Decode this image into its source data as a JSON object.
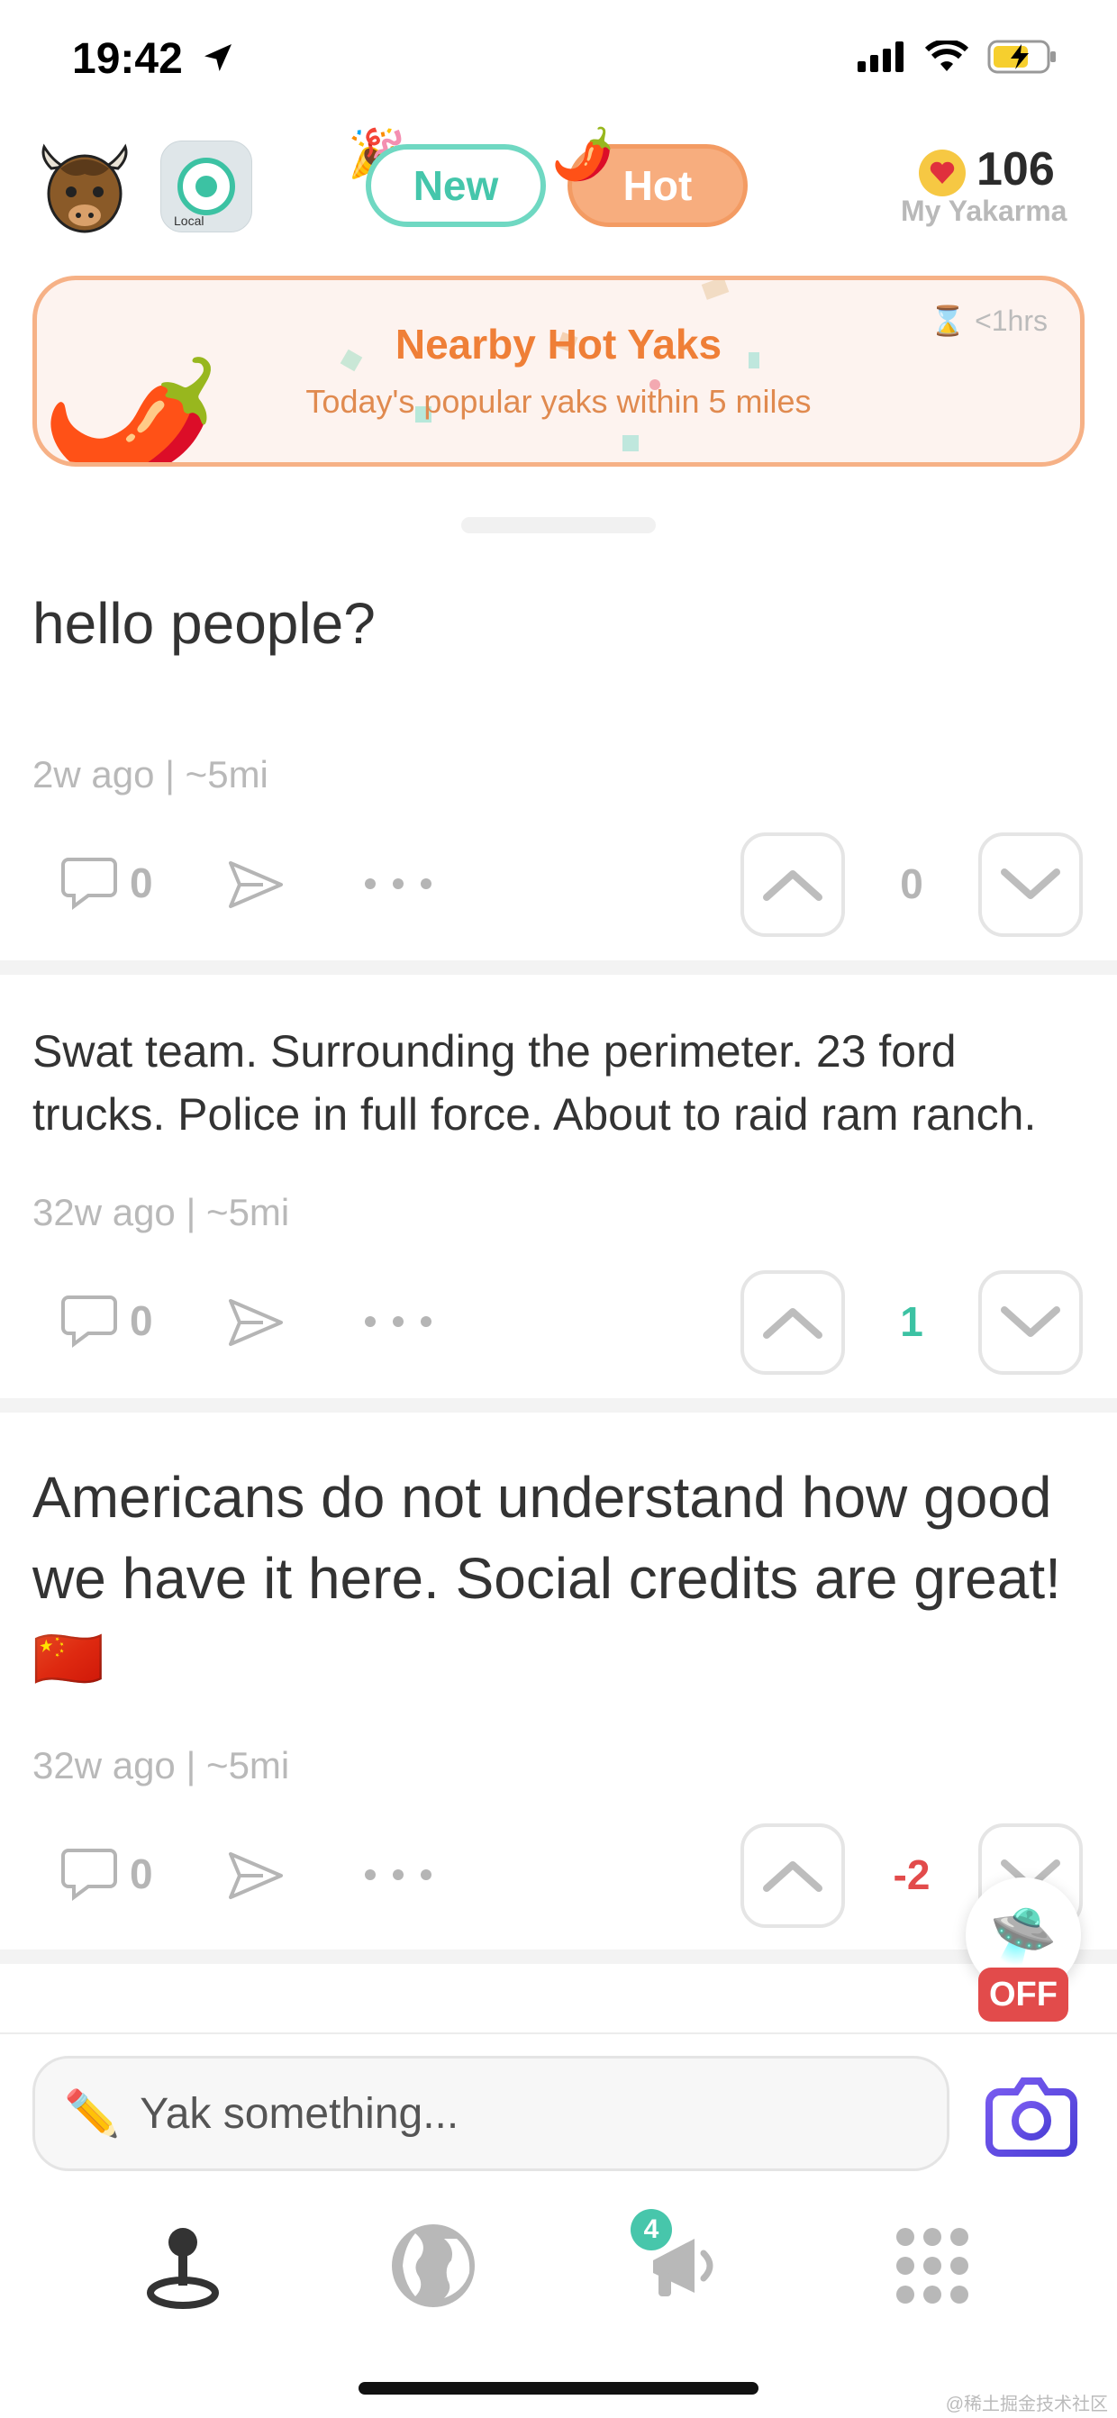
{
  "status_bar": {
    "time": "19:42"
  },
  "header": {
    "tabs": [
      {
        "label": "New"
      },
      {
        "label": "Hot"
      }
    ],
    "yakarma": {
      "count": "106",
      "label": "My Yakarma"
    },
    "local_map_label": "Local"
  },
  "banner": {
    "title": "Nearby Hot Yaks",
    "subtitle": "Today's popular yaks within 5 miles",
    "timer": "<1hrs"
  },
  "posts": [
    {
      "text": "hello people?",
      "meta": "2w ago | ~5mi",
      "comments": "0",
      "score": "0",
      "score_color": "#b5b5b5"
    },
    {
      "text": "Swat team. Surrounding the perimeter. 23 ford trucks. Police in full force. About to raid ram ranch.",
      "meta": "32w ago | ~5mi",
      "comments": "0",
      "score": "1",
      "score_color": "#3cc2a3"
    },
    {
      "text": "Americans do not understand how good we have it here. Social credits are great! 🇨🇳",
      "meta": "32w ago | ~5mi",
      "comments": "0",
      "score": "-2",
      "score_color": "#e24b4b"
    }
  ],
  "floating": {
    "off_label": "OFF"
  },
  "composer": {
    "placeholder": "Yak something..."
  },
  "nav": {
    "badge_count": "4"
  },
  "watermark": "@稀土掘金技术社区",
  "colors": {
    "accent_green": "#45c6ab",
    "accent_orange": "#ef7f37",
    "hot_tab": "#f7ad7e"
  },
  "icons": [
    "location-arrow-icon",
    "signal-icon",
    "wifi-icon",
    "battery-icon",
    "yak-avatar-icon",
    "heart-icon",
    "hourglass-icon",
    "comment-icon",
    "share-icon",
    "more-icon",
    "upvote-icon",
    "downvote-icon",
    "ufo-icon",
    "pencil-icon",
    "camera-icon",
    "location-pin-icon",
    "globe-icon",
    "megaphone-icon",
    "grid-icon"
  ]
}
